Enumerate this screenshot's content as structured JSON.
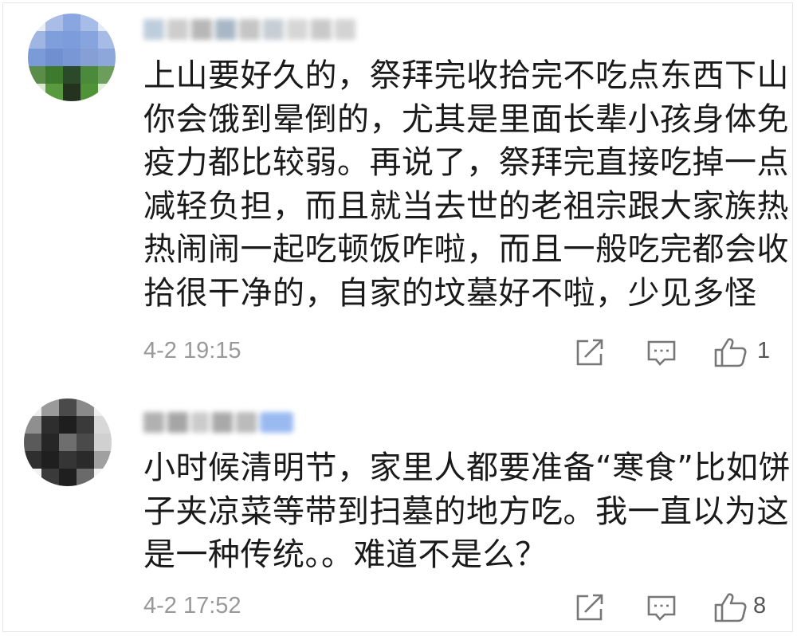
{
  "comments": [
    {
      "avatar_icon": "blurred-avatar",
      "username": "",
      "lines": [
        "上山要好久的，祭拜完收拾完不吃点东西下山",
        "你会饿到晕倒的，尤其是里面长辈小孩身体免",
        "疫力都比较弱。再说了，祭拜完直接吃掉一点",
        "减轻负担，而且就当去世的老祖宗跟大家族热",
        "热闹闹一起吃顿饭咋啦，而且一般吃完都会收",
        "拾很干净的，自家的坟墓好不啦，少见多怪"
      ],
      "time": "4-2 19:15",
      "likes": "1",
      "icons": {
        "share": "share-icon",
        "reply": "comment-icon",
        "like": "thumbs-up-icon"
      }
    },
    {
      "avatar_icon": "blurred-avatar",
      "username": "",
      "lines": [
        "小时候清明节，家里人都要准备“寒食”比如饼",
        "子夹凉菜等带到扫墓的地方吃。我一直以为这",
        "是一种传统。。难道不是么？"
      ],
      "time": "4-2 17:52",
      "likes": "8",
      "icons": {
        "share": "share-icon",
        "reply": "comment-icon",
        "like": "thumbs-up-icon"
      }
    }
  ],
  "colors": {
    "text": "#1a1a1a",
    "meta": "#999999",
    "icon": "#777777"
  }
}
